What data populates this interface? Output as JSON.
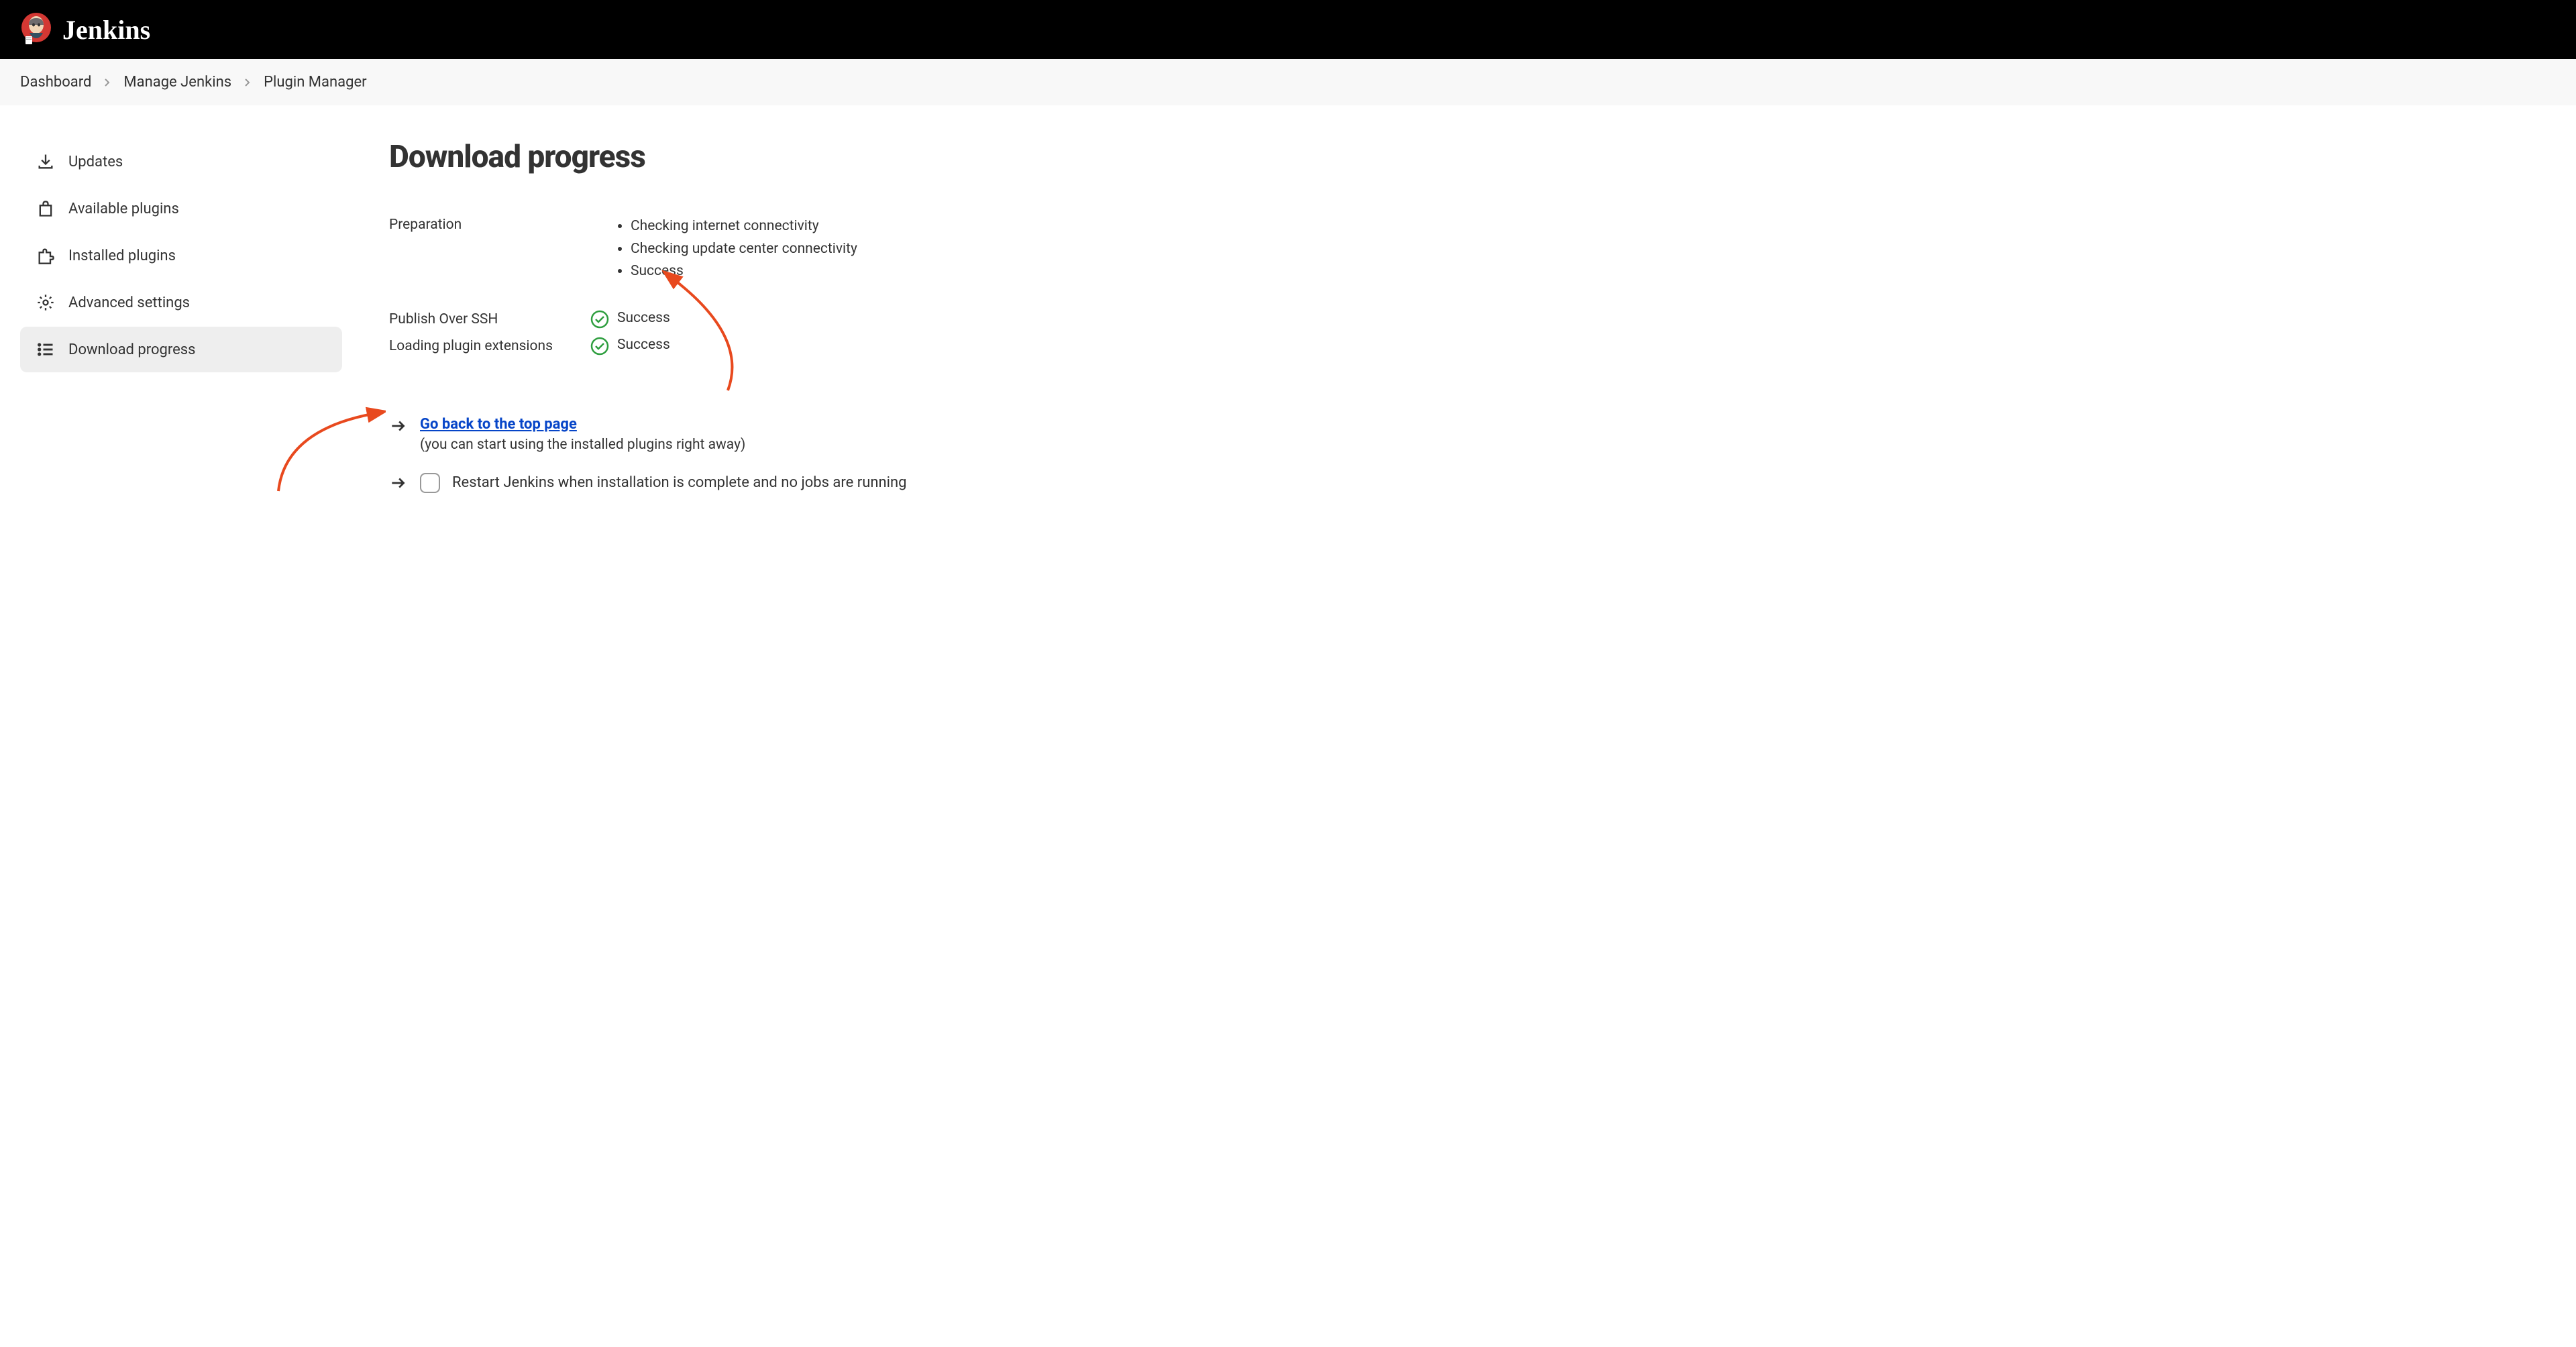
{
  "header": {
    "app_name": "Jenkins"
  },
  "breadcrumbs": [
    "Dashboard",
    "Manage Jenkins",
    "Plugin Manager"
  ],
  "sidebar": {
    "items": [
      {
        "label": "Updates",
        "icon": "download-icon"
      },
      {
        "label": "Available plugins",
        "icon": "shopping-bag-icon"
      },
      {
        "label": "Installed plugins",
        "icon": "puzzle-icon"
      },
      {
        "label": "Advanced settings",
        "icon": "gear-icon"
      },
      {
        "label": "Download progress",
        "icon": "list-icon"
      }
    ]
  },
  "main": {
    "title": "Download progress",
    "preparation": {
      "label": "Preparation",
      "steps": [
        "Checking internet connectivity",
        "Checking update center connectivity",
        "Success"
      ]
    },
    "tasks": [
      {
        "label": "Publish Over SSH",
        "status": "Success"
      },
      {
        "label": "Loading plugin extensions",
        "status": "Success"
      }
    ],
    "actions": {
      "back_link": "Go back to the top page",
      "back_subtext": "(you can start using the installed plugins right away)",
      "restart_label": "Restart Jenkins when installation is complete and no jobs are running"
    }
  }
}
